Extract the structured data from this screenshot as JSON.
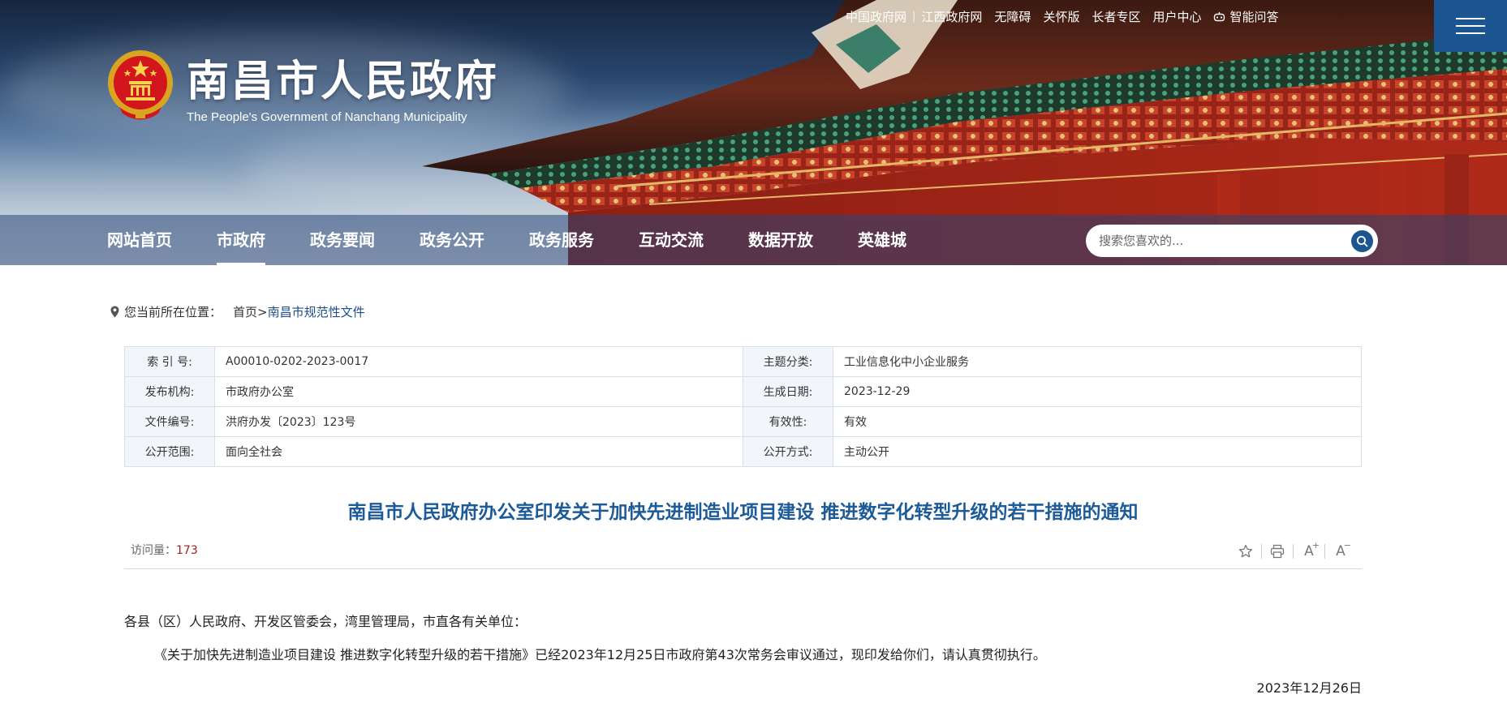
{
  "top_links": {
    "china_gov": "中国政府网",
    "jiangxi_gov": "江西政府网",
    "accessibility": "无障碍",
    "care_version": "关怀版",
    "elderly": "长者专区",
    "user_center": "用户中心",
    "ai_qa": "智能问答"
  },
  "site": {
    "title": "南昌市人民政府",
    "subtitle": "The People's Government of Nanchang Municipality"
  },
  "nav": {
    "items": [
      "网站首页",
      "市政府",
      "政务要闻",
      "政务公开",
      "政务服务",
      "互动交流",
      "数据开放",
      "英雄城"
    ],
    "active": "市政府"
  },
  "search": {
    "placeholder": "搜索您喜欢的..."
  },
  "breadcrumb": {
    "label": "您当前所在位置：",
    "home": "首页",
    "separator": ">",
    "current": "南昌市规范性文件"
  },
  "meta": {
    "index_label": "索 引 号:",
    "index_value": "A00010-0202-2023-0017",
    "topic_label": "主题分类:",
    "topic_value": "工业信息化中小企业服务",
    "publisher_label": "发布机构:",
    "publisher_value": "市政府办公室",
    "created_label": "生成日期:",
    "created_value": "2023-12-29",
    "docno_label": "文件编号:",
    "docno_value": "洪府办发〔2023〕123号",
    "validity_label": "有效性:",
    "validity_value": "有效",
    "scope_label": "公开范围:",
    "scope_value": "面向全社会",
    "method_label": "公开方式:",
    "method_value": "主动公开"
  },
  "article": {
    "title": "南昌市人民政府办公室印发关于加快先进制造业项目建设 推进数字化转型升级的若干措施的通知",
    "visits_label": "访问量：",
    "visits_count": "173",
    "salutation": "各县（区）人民政府、开发区管委会，湾里管理局，市直各有关单位：",
    "body": "《关于加快先进制造业项目建设 推进数字化转型升级的若干措施》已经2023年12月25日市政府第43次常务会审议通过，现印发给你们，请认真贯彻执行。",
    "date": "2023年12月26日"
  },
  "icons": [
    "gov-emblem-icon",
    "robot-icon",
    "hamburger-menu-icon",
    "search-icon",
    "location-pin-icon",
    "star-icon",
    "print-icon",
    "font-increase-icon",
    "font-decrease-icon"
  ],
  "colors": {
    "nav_active": "#ffffff",
    "title_blue": "#1d5a98",
    "brand_blue": "#1b5592",
    "visits_red": "#a02020"
  }
}
